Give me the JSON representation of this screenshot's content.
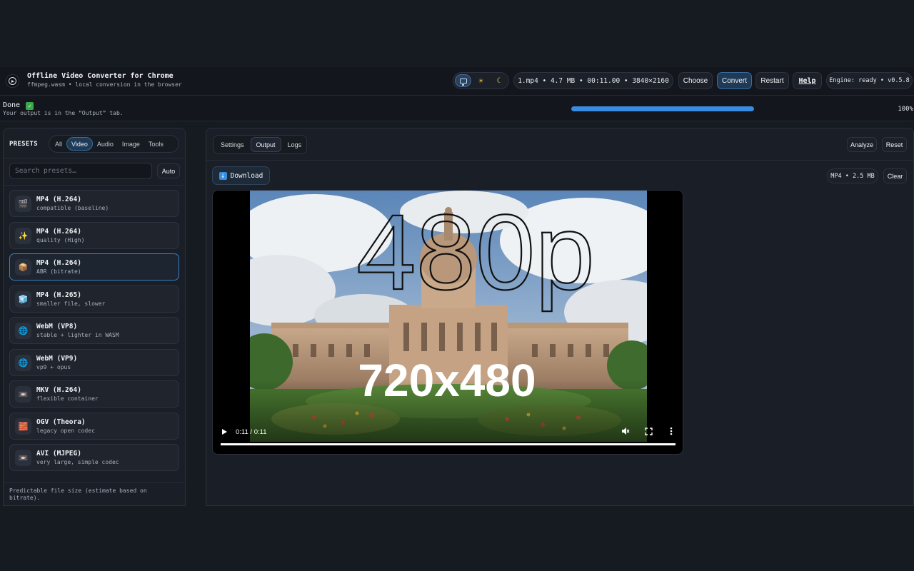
{
  "header": {
    "app_title": "Offline Video Converter for Chrome",
    "app_subtitle": "ffmpeg.wasm • local conversion in the browser",
    "theme_modes": [
      "system",
      "light",
      "dark"
    ],
    "file_info": "1.mp4 • 4.7 MB • 00:11.00 • 3840×2160",
    "choose_label": "Choose",
    "convert_label": "Convert",
    "restart_label": "Restart",
    "help_label": "Help",
    "engine_status": "Engine: ready • v0.5.8"
  },
  "status": {
    "title": "Done",
    "subtitle": "Your output is in the “Output” tab.",
    "progress": 1.0,
    "progress_text": "100%"
  },
  "presets": {
    "title": "PRESETS",
    "filters": [
      "All",
      "Video",
      "Audio",
      "Image",
      "Tools"
    ],
    "active_filter": "Video",
    "search_placeholder": "Search presets…",
    "auto_label": "Auto",
    "items": [
      {
        "icon": "clapperboard-icon",
        "glyph": "🎬",
        "name": "MP4 (H.264)",
        "desc": "compatible (baseline)"
      },
      {
        "icon": "sparkles-icon",
        "glyph": "✨",
        "name": "MP4 (H.264)",
        "desc": "quality (High)"
      },
      {
        "icon": "package-icon",
        "glyph": "📦",
        "name": "MP4 (H.264)",
        "desc": "ABR (bitrate)",
        "selected": true
      },
      {
        "icon": "ice-cube-icon",
        "glyph": "🧊",
        "name": "MP4 (H.265)",
        "desc": "smaller file, slower"
      },
      {
        "icon": "globe-icon",
        "glyph": "🌐",
        "name": "WebM (VP8)",
        "desc": "stable + lighter in WASM"
      },
      {
        "icon": "globe-icon",
        "glyph": "🌐",
        "name": "WebM (VP9)",
        "desc": "vp9 + opus"
      },
      {
        "icon": "videocassette-icon",
        "glyph": "📼",
        "name": "MKV (H.264)",
        "desc": "flexible container"
      },
      {
        "icon": "brick-icon",
        "glyph": "🧱",
        "name": "OGV (Theora)",
        "desc": "legacy open codec"
      },
      {
        "icon": "videocassette-icon",
        "glyph": "📼",
        "name": "AVI (MJPEG)",
        "desc": "very large, simple codec"
      }
    ],
    "footer": "Predictable file size (estimate based on bitrate)."
  },
  "main": {
    "tabs": [
      "Settings",
      "Output",
      "Logs"
    ],
    "active_tab": "Output",
    "analyze_label": "Analyze",
    "reset_label": "Reset",
    "download_label": "Download",
    "output_info": "MP4 • 2.5 MB",
    "clear_label": "Clear"
  },
  "video": {
    "overlay_top": "480p",
    "overlay_bottom": "720x480",
    "time": "0:11 / 0:11",
    "progress": 1.0
  }
}
